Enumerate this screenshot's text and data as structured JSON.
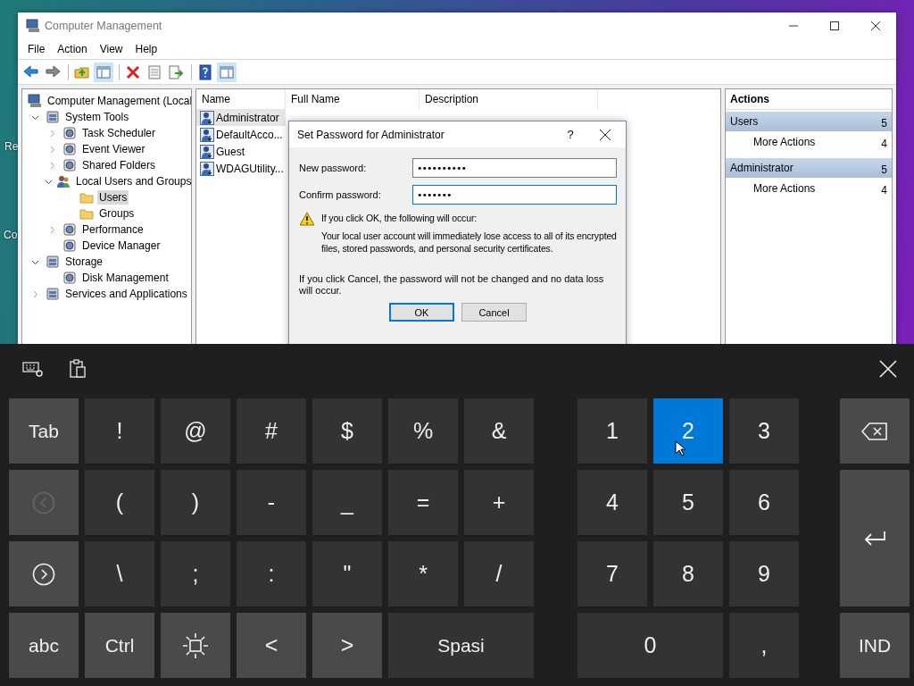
{
  "desktop": {
    "icon_labels": [
      "Re",
      "Co"
    ]
  },
  "window": {
    "title": "Computer Management",
    "menu": [
      "File",
      "Action",
      "View",
      "Help"
    ],
    "toolbar": [
      {
        "kind": "back",
        "pressed": false
      },
      {
        "kind": "forward",
        "pressed": false
      },
      {
        "kind": "separator"
      },
      {
        "kind": "up",
        "pressed": false
      },
      {
        "kind": "tree",
        "pressed": true
      },
      {
        "kind": "separator"
      },
      {
        "kind": "delete",
        "pressed": false
      },
      {
        "kind": "properties",
        "pressed": false
      },
      {
        "kind": "export",
        "pressed": false
      },
      {
        "kind": "separator"
      },
      {
        "kind": "help",
        "pressed": false
      },
      {
        "kind": "actions",
        "pressed": true
      }
    ],
    "tree": {
      "label": "Computer Management (Local",
      "kind": "computer",
      "selected": false,
      "children": [
        {
          "label": "System Tools",
          "kind": "tools",
          "expanded": true,
          "selected": false,
          "children": [
            {
              "label": "Task Scheduler",
              "kind": "tool",
              "expanded": false,
              "selected": false
            },
            {
              "label": "Event Viewer",
              "kind": "tool",
              "expanded": false,
              "selected": false
            },
            {
              "label": "Shared Folders",
              "kind": "tool",
              "expanded": false,
              "selected": false
            },
            {
              "label": "Local Users and Groups",
              "kind": "users",
              "expanded": true,
              "selected": false,
              "children": [
                {
                  "label": "Users",
                  "kind": "folder",
                  "selected": true
                },
                {
                  "label": "Groups",
                  "kind": "folder",
                  "selected": false
                }
              ]
            },
            {
              "label": "Performance",
              "kind": "tool",
              "expanded": false,
              "selected": false
            },
            {
              "label": "Device Manager",
              "kind": "tool",
              "selected": false
            }
          ]
        },
        {
          "label": "Storage",
          "kind": "tools",
          "expanded": true,
          "selected": false,
          "children": [
            {
              "label": "Disk Management",
              "kind": "tool",
              "selected": false
            }
          ]
        },
        {
          "label": "Services and Applications",
          "kind": "tools",
          "expanded": false,
          "selected": false
        }
      ]
    },
    "list": {
      "columns": [
        "Name",
        "Full Name",
        "Description"
      ],
      "rows": [
        {
          "name": "Administrator",
          "selected": true
        },
        {
          "name": "DefaultAcco...",
          "selected": false
        },
        {
          "name": "Guest",
          "selected": false
        },
        {
          "name": "WDAGUtility...",
          "selected": false
        }
      ]
    },
    "actions": {
      "title": "Actions",
      "groups": [
        {
          "title": "Users",
          "marker": "5",
          "items": [
            {
              "label": "More Actions",
              "marker": "4"
            }
          ]
        },
        {
          "title": "Administrator",
          "marker": "5",
          "items": [
            {
              "label": "More Actions",
              "marker": "4"
            }
          ]
        }
      ]
    }
  },
  "dialog": {
    "title": "Set Password for Administrator",
    "help": "?",
    "fields": [
      {
        "label": "New password:",
        "value": "••••••••••",
        "focused": false
      },
      {
        "label": "Confirm password:",
        "value": "•••••••",
        "focused": true
      }
    ],
    "warning_title": "If you click OK, the following will occur:",
    "warning_text": "Your local user account will immediately lose access to all of its encrypted files, stored passwords, and personal security certificates.",
    "cancel_note": "If you click Cancel, the password will not be changed and no data loss will occur.",
    "buttons": [
      {
        "label": "OK",
        "default": true
      },
      {
        "label": "Cancel",
        "default": false
      }
    ]
  },
  "keyboard": {
    "left_keys": [
      {
        "kind": "char",
        "label": "Tab",
        "function": true,
        "selected": false,
        "disabled": false
      },
      {
        "kind": "char",
        "label": "!",
        "function": false,
        "selected": false,
        "disabled": false
      },
      {
        "kind": "char",
        "label": "@",
        "function": false,
        "selected": false,
        "disabled": false
      },
      {
        "kind": "char",
        "label": "#",
        "function": false,
        "selected": false,
        "disabled": false
      },
      {
        "kind": "char",
        "label": "$",
        "function": false,
        "selected": false,
        "disabled": false
      },
      {
        "kind": "char",
        "label": "%",
        "function": false,
        "selected": false,
        "disabled": false
      },
      {
        "kind": "char",
        "label": "&",
        "function": false,
        "selected": false,
        "disabled": false
      },
      {
        "kind": "back",
        "function": true,
        "selected": false,
        "disabled": true
      },
      {
        "kind": "char",
        "label": "(",
        "function": false,
        "selected": false,
        "disabled": false
      },
      {
        "kind": "char",
        "label": ")",
        "function": false,
        "selected": false,
        "disabled": false
      },
      {
        "kind": "char",
        "label": "-",
        "function": false,
        "selected": false,
        "disabled": false
      },
      {
        "kind": "char",
        "label": "_",
        "function": false,
        "selected": false,
        "disabled": false
      },
      {
        "kind": "char",
        "label": "=",
        "function": false,
        "selected": false,
        "disabled": false
      },
      {
        "kind": "char",
        "label": "+",
        "function": false,
        "selected": false,
        "disabled": false
      },
      {
        "kind": "forward",
        "function": true,
        "selected": false,
        "disabled": false
      },
      {
        "kind": "char",
        "label": "\\",
        "function": false,
        "selected": false,
        "disabled": false
      },
      {
        "kind": "char",
        "label": ";",
        "function": false,
        "selected": false,
        "disabled": false
      },
      {
        "kind": "char",
        "label": ":",
        "function": false,
        "selected": false,
        "disabled": false
      },
      {
        "kind": "char",
        "label": "\"",
        "function": false,
        "selected": false,
        "disabled": false
      },
      {
        "kind": "char",
        "label": "*",
        "function": false,
        "selected": false,
        "disabled": false
      },
      {
        "kind": "char",
        "label": "/",
        "function": false,
        "selected": false,
        "disabled": false
      },
      {
        "kind": "char",
        "label": "abc",
        "function": true,
        "selected": false,
        "disabled": false
      },
      {
        "kind": "char",
        "label": "Ctrl",
        "function": true,
        "selected": false,
        "disabled": false
      },
      {
        "kind": "light",
        "function": true,
        "selected": false,
        "disabled": false
      },
      {
        "kind": "char",
        "label": "<",
        "function": true,
        "selected": false,
        "disabled": false
      },
      {
        "kind": "char",
        "label": ">",
        "function": true,
        "selected": false,
        "disabled": false
      },
      {
        "kind": "char",
        "label": "Spasi",
        "function": false,
        "wide": true,
        "selected": false,
        "disabled": false
      }
    ],
    "numpad_keys": [
      {
        "kind": "char",
        "label": "1",
        "function": false,
        "selected": false,
        "disabled": false
      },
      {
        "kind": "char",
        "label": "2",
        "function": false,
        "selected": true,
        "disabled": false
      },
      {
        "kind": "char",
        "label": "3",
        "function": false,
        "selected": false,
        "disabled": false
      },
      {
        "kind": "char",
        "label": "4",
        "function": false,
        "selected": false,
        "disabled": false
      },
      {
        "kind": "char",
        "label": "5",
        "function": false,
        "selected": false,
        "disabled": false
      },
      {
        "kind": "char",
        "label": "6",
        "function": false,
        "selected": false,
        "disabled": false
      },
      {
        "kind": "char",
        "label": "7",
        "function": false,
        "selected": false,
        "disabled": false
      },
      {
        "kind": "char",
        "label": "8",
        "function": false,
        "selected": false,
        "disabled": false
      },
      {
        "kind": "char",
        "label": "9",
        "function": false,
        "selected": false,
        "disabled": false
      },
      {
        "kind": "char",
        "label": "0",
        "function": false,
        "wide": true,
        "selected": false,
        "disabled": false
      },
      {
        "kind": "char",
        "label": ",",
        "function": false,
        "selected": false,
        "disabled": false
      }
    ],
    "side_keys": [
      {
        "kind": "backspace",
        "function": true,
        "selected": false,
        "disabled": false
      },
      {
        "kind": "enter",
        "function": true,
        "tall": true,
        "selected": false,
        "disabled": false
      },
      {
        "kind": "char",
        "label": "IND",
        "function": true,
        "selected": false,
        "disabled": false
      }
    ]
  }
}
